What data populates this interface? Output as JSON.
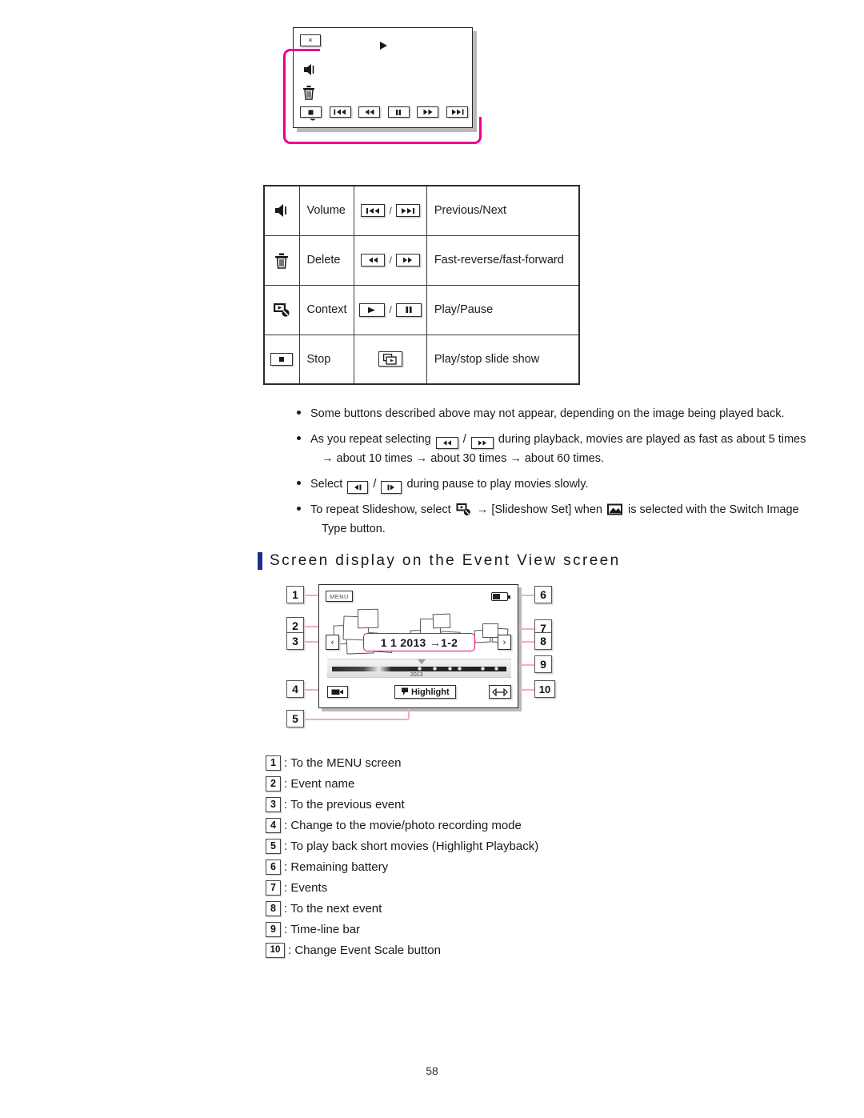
{
  "top_diagram": {
    "close_label": "×",
    "left_icons": [
      "volume-icon",
      "delete-icon",
      "context-icon"
    ],
    "bottom_buttons": [
      "stop-icon",
      "previous-icon",
      "fast-reverse-icon",
      "pause-icon",
      "fast-forward-icon",
      "next-icon"
    ],
    "highlight_color": "#ec008c"
  },
  "button_table": {
    "rows": [
      {
        "icon": "volume-icon",
        "label": "Volume",
        "pair": [
          "previous-icon",
          "next-icon"
        ],
        "separator": "/",
        "desc": "Previous/Next"
      },
      {
        "icon": "delete-icon",
        "label": "Delete",
        "pair": [
          "fast-reverse-icon",
          "fast-forward-icon"
        ],
        "separator": "/",
        "desc": "Fast-reverse/fast-forward"
      },
      {
        "icon": "context-icon",
        "label": "Context",
        "pair": [
          "play-icon",
          "pause-icon"
        ],
        "separator": "/",
        "desc": "Play/Pause"
      },
      {
        "icon": "stop-icon",
        "label": "Stop",
        "pair": [
          "slideshow-icon"
        ],
        "separator": "",
        "desc": "Play/stop slide show"
      }
    ]
  },
  "notes": [
    {
      "text": "Some buttons described above may not appear, depending on the image being played back."
    },
    {
      "pre": "As you repeat selecting",
      "mid": "during playback, movies are played as fast as about 5 times",
      "cont": "→ about 10 times → about 30 times → about 60 times.",
      "separator": "/"
    },
    {
      "pre": "Select",
      "mid": "during pause to play movies slowly.",
      "separator": "/"
    },
    {
      "pre": "To repeat Slideshow, select",
      "arrow": "→",
      "mid": "[Slideshow Set] when",
      "post": "is selected with the Switch Image",
      "cont": "Type button."
    }
  ],
  "section": {
    "heading": "Screen display on the Event View screen",
    "accent_color": "#1f2d8a"
  },
  "event_view": {
    "menu_label": "MENU",
    "event_name": "1 1 2013 →1-2",
    "timeline_year": "2013",
    "highlight_label": "Highlight",
    "prev_label": "‹",
    "next_label": "›",
    "callouts": [
      "1",
      "2",
      "3",
      "4",
      "5",
      "6",
      "7",
      "8",
      "9",
      "10"
    ]
  },
  "legend": [
    {
      "num": "1",
      "text": ": To the MENU screen"
    },
    {
      "num": "2",
      "text": ": Event name"
    },
    {
      "num": "3",
      "text": ": To the previous event"
    },
    {
      "num": "4",
      "text": ": Change to the movie/photo recording mode"
    },
    {
      "num": "5",
      "text": ": To play back short movies (Highlight Playback)"
    },
    {
      "num": "6",
      "text": ": Remaining battery"
    },
    {
      "num": "7",
      "text": ": Events"
    },
    {
      "num": "8",
      "text": ": To the next event"
    },
    {
      "num": "9",
      "text": ": Time-line bar"
    },
    {
      "num": "10",
      "text": ": Change Event Scale button"
    }
  ],
  "footer": {
    "page_number": "58"
  }
}
